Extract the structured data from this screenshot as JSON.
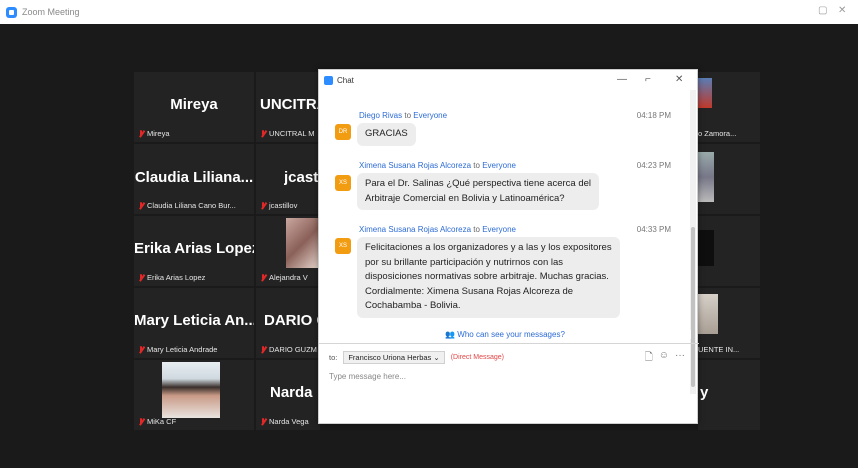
{
  "window": {
    "title": "Zoom Meeting"
  },
  "tiles": [
    {
      "name": "Mireya",
      "label": "Mireya"
    },
    {
      "name": "UNCITRA",
      "label": "UNCITRAL M"
    },
    {
      "name": "Claudia Liliana...",
      "label": "Claudia Liliana Cano Bur..."
    },
    {
      "name": "jcast",
      "label": "jcastillov"
    },
    {
      "name": "Erika Arias Lopez",
      "label": "Erika Arias Lopez"
    },
    {
      "name": "",
      "label": "Alejandra V"
    },
    {
      "name": "Mary Leticia An...",
      "label": "Mary Leticia Andrade"
    },
    {
      "name": "DARIO G",
      "label": "DARIO GUZM"
    },
    {
      "name": "",
      "label": "MiKa CF"
    },
    {
      "name": "Narda",
      "label": "Narda Vega"
    }
  ],
  "right_tiles": [
    {
      "label": "o Zamora..."
    },
    {
      "label": "UENTE IN..."
    },
    {
      "name": "y"
    }
  ],
  "chat": {
    "title": "Chat",
    "messages": [
      {
        "initials": "DR",
        "sender": "Diego Rivas",
        "to": "to",
        "recipient": "Everyone",
        "time": "04:18 PM",
        "lines": [
          "GRACIAS"
        ]
      },
      {
        "initials": "XS",
        "sender": "Ximena Susana Rojas Alcoreza",
        "to": "to",
        "recipient": "Everyone",
        "time": "04:23 PM",
        "lines": [
          "Para el Dr. Salinas ¿Qué perspectiva tiene acerca del",
          "Arbitraje Comercial en Bolivia y Latinoamérica?"
        ]
      },
      {
        "initials": "XS",
        "sender": "Ximena Susana Rojas Alcoreza",
        "to": "to",
        "recipient": "Everyone",
        "time": "04:33 PM",
        "lines": [
          "Felicitaciones a los organizadores y a las y los expositores",
          "por su brillante participación y nutrirnos con las",
          "disposiciones normativas sobre arbitraje. Muchas gracias.",
          "Cordialmente: Ximena Susana Rojas Alcoreza de",
          "Cochabamba - Bolivia."
        ]
      }
    ],
    "who_can_see": "Who can see your messages?",
    "to_label": "to:",
    "to_value": "Francisco Uriona Herbas",
    "direct_message": "(Direct Message)",
    "input_placeholder": "Type message here..."
  }
}
